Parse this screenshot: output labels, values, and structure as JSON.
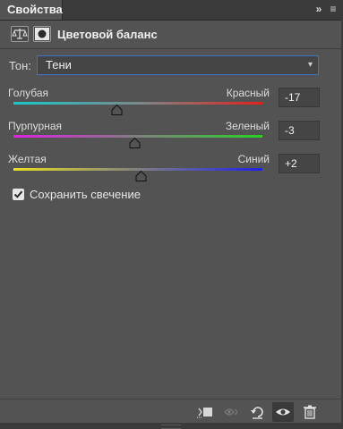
{
  "tab": {
    "title": "Свойства",
    "collapse_glyph": "»",
    "menu_glyph": "≡"
  },
  "header": {
    "title": "Цветовой баланс",
    "icons": [
      "balance-scale-icon",
      "layer-mask-icon"
    ]
  },
  "tone": {
    "label": "Тон:",
    "selected": "Тени"
  },
  "sliders": [
    {
      "left": "Голубая",
      "right": "Красный",
      "value": "-17",
      "numeric": -17,
      "colors": [
        "#18c8cc",
        "#e02020"
      ]
    },
    {
      "left": "Пурпурная",
      "right": "Зеленый",
      "value": "-3",
      "numeric": -3,
      "colors": [
        "#e020e0",
        "#28d028"
      ]
    },
    {
      "left": "Желтая",
      "right": "Синий",
      "value": "+2",
      "numeric": 2,
      "colors": [
        "#e8e020",
        "#2020e8"
      ]
    }
  ],
  "slider_range": [
    -100,
    100
  ],
  "preserve": {
    "label": "Сохранить свечение",
    "checked": true
  },
  "toolbar_icons": [
    "clip-to-layer-icon",
    "view-previous-state-icon",
    "reset-icon",
    "visibility-eye-icon",
    "trash-icon"
  ],
  "colors": {
    "accent_border": "#3c73c4",
    "panel_bg": "#535353"
  }
}
